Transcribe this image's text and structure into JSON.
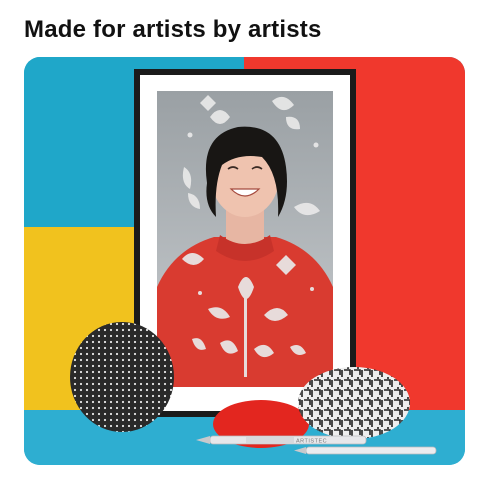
{
  "headline": "Made for artists by artists",
  "pen_brand": "ARTISTEC",
  "colors": {
    "wall_blue": "#1fa7c9",
    "wall_red": "#f0382d",
    "wall_yellow": "#f1c21e",
    "floor_blue": "#2eaed1",
    "frame": "#1b1b1b",
    "mat": "#ffffff",
    "sweater": "#d93b30",
    "floral": "#e9e9e9"
  },
  "icons": {
    "frame": "framed-portrait",
    "flowers": "floral-overlay",
    "stone_dots": "dotted-stone",
    "stone_maze": "maze-stone",
    "stone_red": "red-stone",
    "pens": "drawing-pens"
  }
}
